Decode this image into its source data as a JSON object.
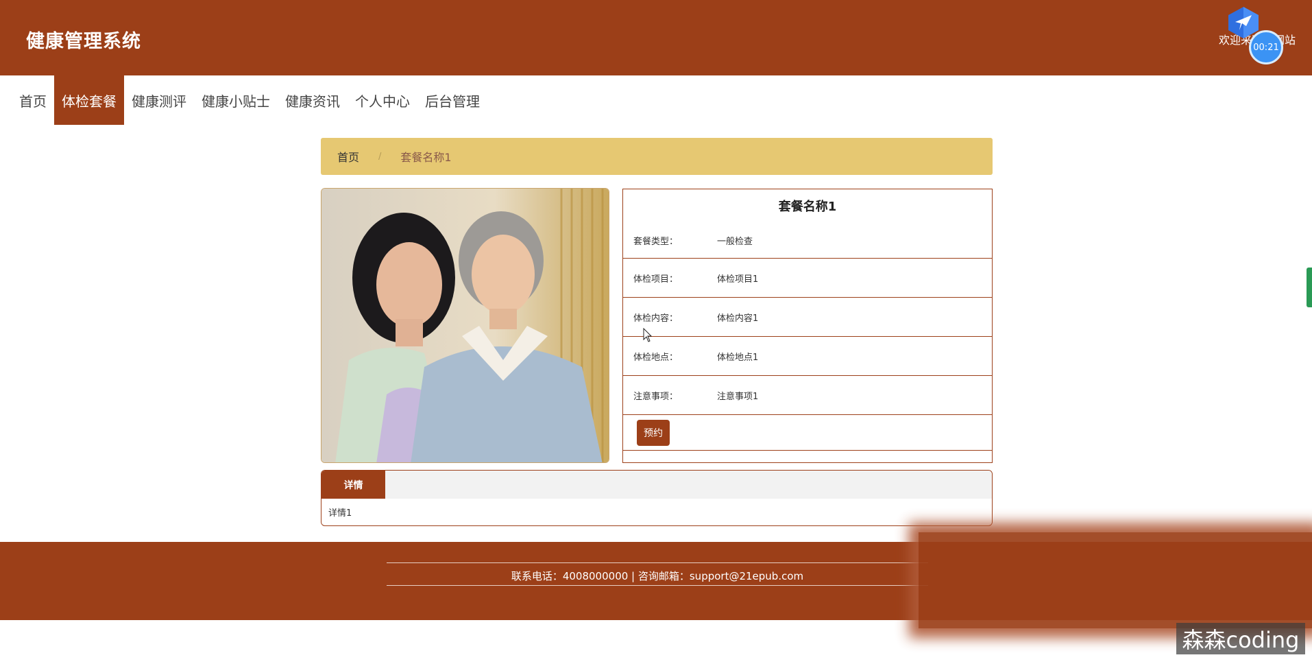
{
  "header": {
    "title": "健康管理系统",
    "welcome": "欢迎来到本网站",
    "timer": "00:21",
    "bg_color": "#9c3f18"
  },
  "nav": {
    "items": [
      "首页",
      "体检套餐",
      "健康测评",
      "健康小贴士",
      "健康资讯",
      "个人中心",
      "后台管理"
    ],
    "active": "体检套餐"
  },
  "breadcrumb": {
    "home": "首页",
    "separator": "/",
    "current": "套餐名称1"
  },
  "package": {
    "title": "套餐名称1",
    "fields": [
      {
        "label": "套餐类型：",
        "value": "一般检查"
      },
      {
        "label": "体检项目：",
        "value": "体检项目1"
      },
      {
        "label": "体检内容：",
        "value": "体检内容1"
      },
      {
        "label": "体检地点：",
        "value": "体检地点1"
      },
      {
        "label": "注意事项：",
        "value": "注意事项1"
      }
    ],
    "book_label": "预约"
  },
  "detail": {
    "tab_label": "详情",
    "content": "详情1"
  },
  "footer": {
    "contact": "联系电话：4008000000 | 咨询邮箱：support@21epub.com"
  },
  "watermark": "森森coding"
}
